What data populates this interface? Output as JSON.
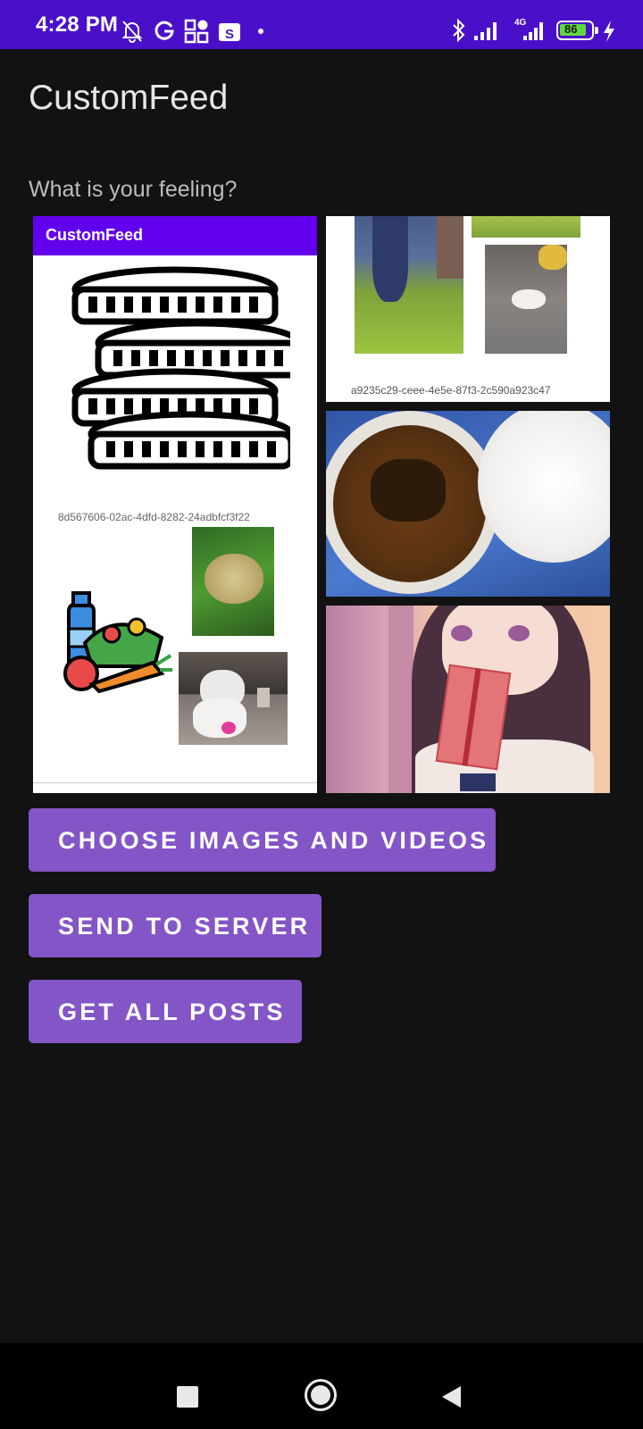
{
  "status_bar": {
    "time": "4:28 PM",
    "network_label": "4G",
    "battery_level": "86",
    "icons": [
      "mute-bell-icon",
      "g-icon",
      "apps-icon",
      "s-app-icon",
      "dot-icon",
      "bluetooth-icon",
      "signal-icon",
      "signal-4g-icon",
      "battery-icon",
      "charging-icon"
    ]
  },
  "app": {
    "title": "CustomFeed",
    "feeling_placeholder": "What is your feeling?"
  },
  "feed": {
    "post1": {
      "header": "CustomFeed",
      "id": "8d567606-02ac-4dfd-8282-24adbfcf3f22"
    },
    "post2": {
      "id": "a9235c29-ceee-4e5e-87f3-2c590a923c47"
    }
  },
  "buttons": {
    "choose": "CHOOSE IMAGES AND VIDEOS",
    "send": "SEND TO SERVER",
    "get": "GET ALL POSTS"
  },
  "colors": {
    "status_bar": "#4a10c9",
    "accent_header": "#6200ee",
    "button": "#8355c6",
    "background": "#121212"
  },
  "nav_bar": {
    "icons": [
      "recents-square-icon",
      "home-circle-icon",
      "back-triangle-icon"
    ]
  }
}
